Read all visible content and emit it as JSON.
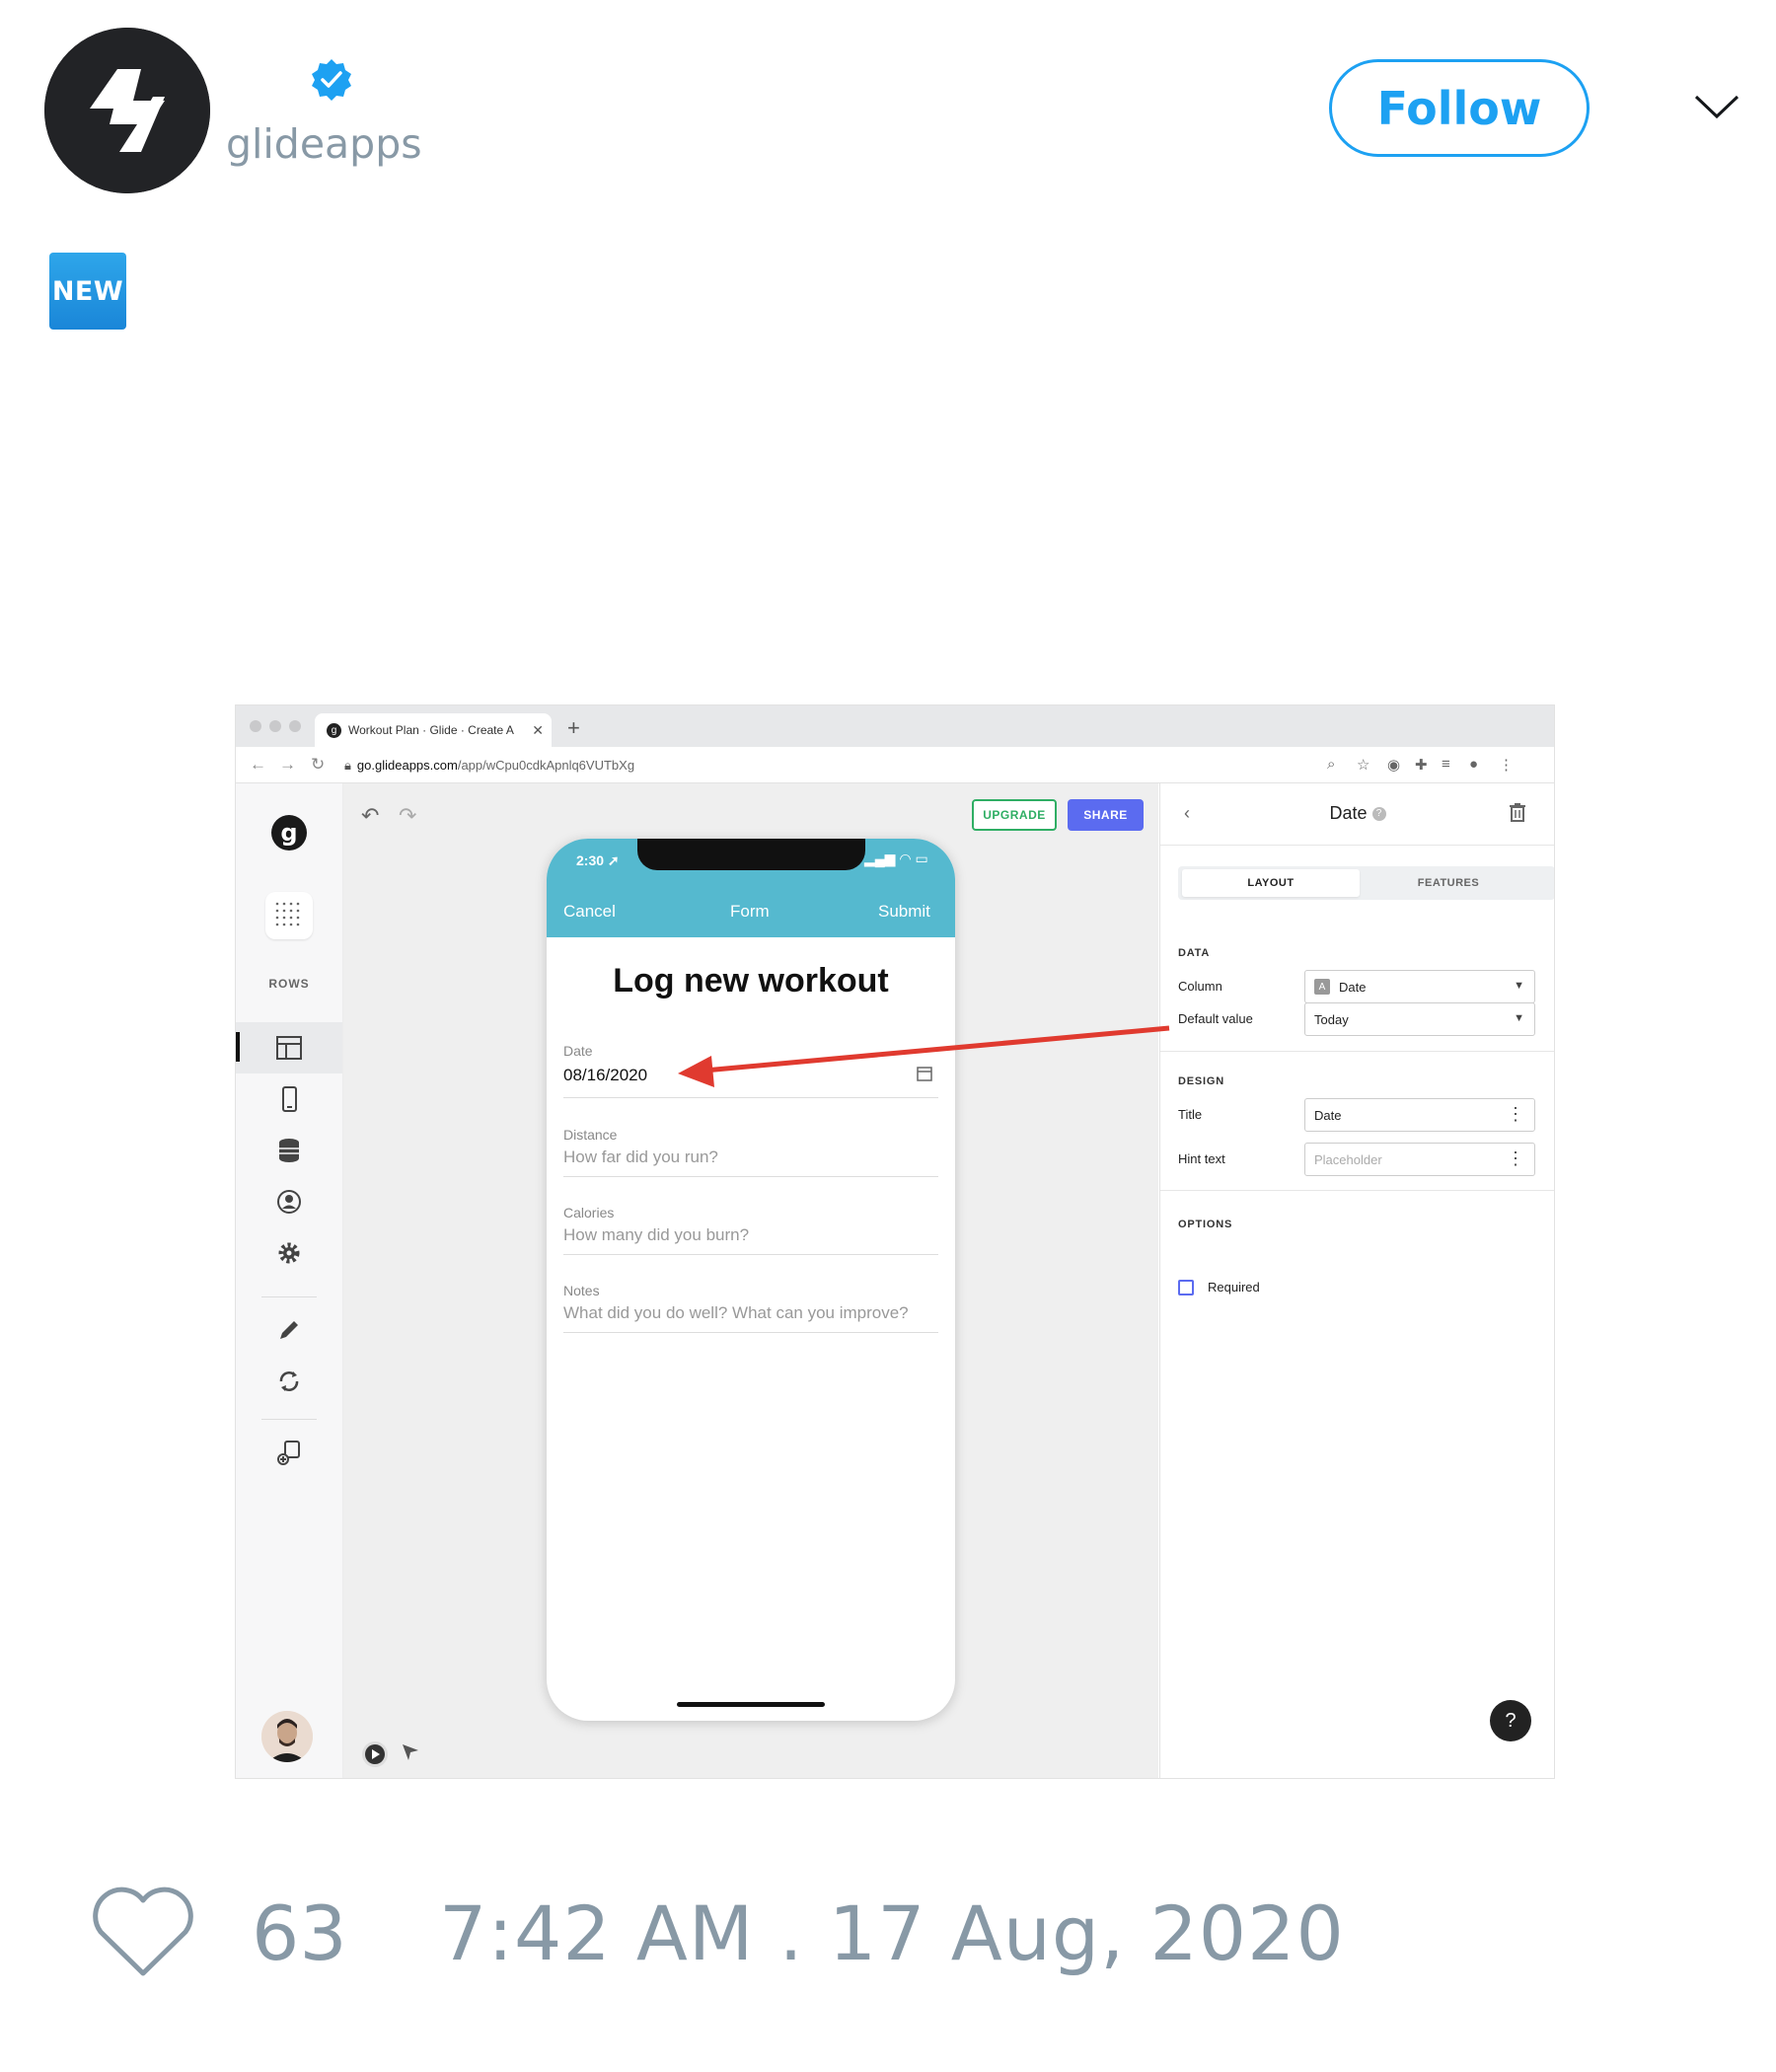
{
  "tweet": {
    "handle": "glideapps",
    "follow_label": "Follow",
    "badge_text": "NEW",
    "likes": "63",
    "timestamp": "7:42 AM . 17 Aug, 2020"
  },
  "browser": {
    "tab_title": "Workout Plan · Glide · Create A",
    "tab_favicon": "g",
    "url_host": "go.glideapps.com",
    "url_path": "/app/wCpu0cdkApnlq6VUTbXg"
  },
  "glide": {
    "logo_letter": "g",
    "rows_label": "ROWS",
    "upgrade_label": "UPGRADE",
    "share_label": "SHARE",
    "phone": {
      "time": "2:30",
      "nav_left": "Cancel",
      "nav_center": "Form",
      "nav_right": "Submit",
      "form_title": "Log new workout",
      "fields": [
        {
          "label": "Date",
          "value": "08/16/2020"
        },
        {
          "label": "Distance",
          "placeholder": "How far did you run?"
        },
        {
          "label": "Calories",
          "placeholder": "How many did you burn?"
        },
        {
          "label": "Notes",
          "placeholder": "What did you do well? What can you improve?"
        }
      ]
    },
    "panel": {
      "title": "Date",
      "tab_layout": "LAYOUT",
      "tab_features": "FEATURES",
      "section_data": "DATA",
      "column_label": "Column",
      "column_value": "Date",
      "default_label": "Default value",
      "default_value": "Today",
      "section_design": "DESIGN",
      "title_label": "Title",
      "title_value": "Date",
      "hint_label": "Hint text",
      "hint_placeholder": "Placeholder",
      "section_options": "OPTIONS",
      "required_label": "Required",
      "help_label": "?"
    }
  },
  "colors": {
    "twitter_blue": "#1da1f2",
    "muted_gray": "#8899a6",
    "phone_header": "#55b9cf",
    "share_button": "#5b6bf0",
    "upgrade_green": "#2fae64",
    "arrow_red": "#e03a2f"
  },
  "icons": {
    "verified": "verified-badge-icon",
    "more": "chevron-down-icon",
    "like": "heart-icon"
  }
}
